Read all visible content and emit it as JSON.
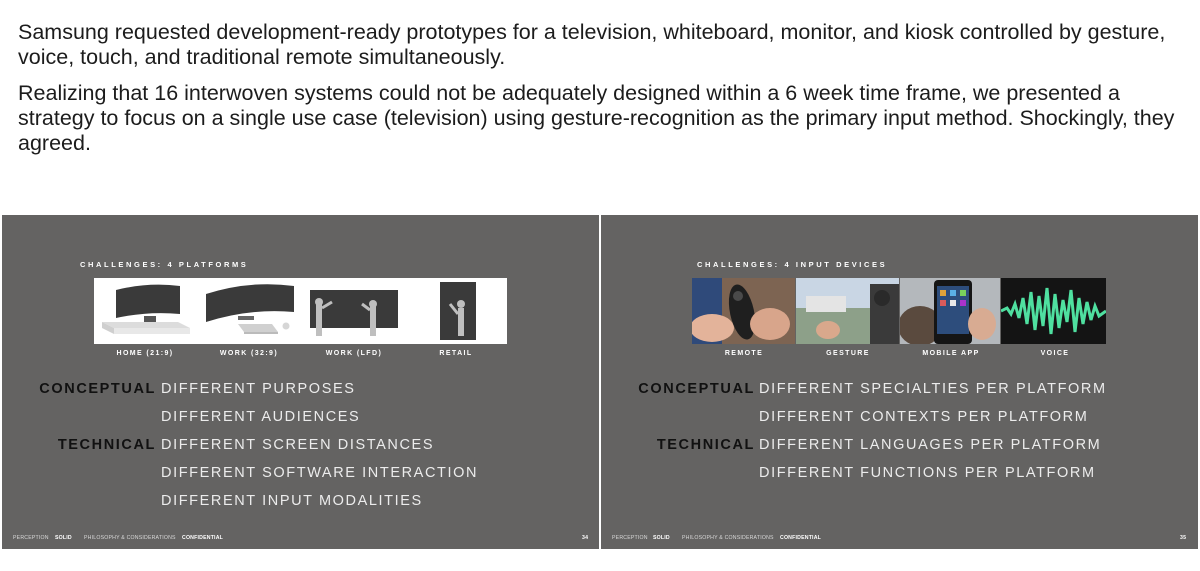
{
  "intro": {
    "paragraph1": "Samsung requested development-ready prototypes for a television, whiteboard, monitor, and kiosk controlled by gesture, voice, touch, and traditional remote simultaneously.",
    "paragraph2": "Realizing that 16 interwoven systems could not be adequately designed within a 6 week time frame, we presented a strategy to focus on a single use case (television) using gesture-recognition as the primary input method. Shockingly, they agreed."
  },
  "slide_left": {
    "heading": "CHALLENGES: 4 PLATFORMS",
    "platforms": [
      "HOME (21:9)",
      "WORK (32:9)",
      "WORK (LFD)",
      "RETAIL"
    ],
    "conceptual_label": "CONCEPTUAL",
    "technical_label": "TECHNICAL",
    "items": [
      "DIFFERENT PURPOSES",
      "DIFFERENT AUDIENCES",
      "DIFFERENT SCREEN DISTANCES",
      "DIFFERENT SOFTWARE INTERACTION",
      "DIFFERENT INPUT MODALITIES"
    ],
    "footer": {
      "perception": "PERCEPTION",
      "solid": "SOLID",
      "philosophy": "PHILOSOPHY & CONSIDERATIONS",
      "confidential": "CONFIDENTIAL",
      "page": "34"
    }
  },
  "slide_right": {
    "heading": "CHALLENGES: 4 INPUT DEVICES",
    "devices": [
      "REMOTE",
      "GESTURE",
      "MOBILE APP",
      "VOICE"
    ],
    "conceptual_label": "CONCEPTUAL",
    "technical_label": "TECHNICAL",
    "items": [
      "DIFFERENT SPECIALTIES PER PLATFORM",
      "DIFFERENT CONTEXTS PER PLATFORM",
      "DIFFERENT LANGUAGES PER PLATFORM",
      "DIFFERENT FUNCTIONS PER PLATFORM"
    ],
    "footer": {
      "perception": "PERCEPTION",
      "solid": "SOLID",
      "philosophy": "PHILOSOPHY & CONSIDERATIONS",
      "confidential": "CONFIDENTIAL",
      "page": "35"
    }
  },
  "colors": {
    "slide_bg": "#646362",
    "voice_wave": "#4fe0a0"
  }
}
